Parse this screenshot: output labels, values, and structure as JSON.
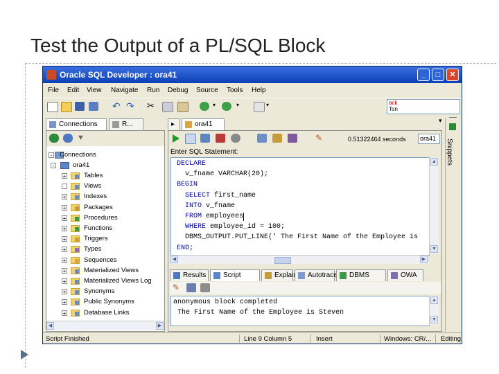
{
  "slide": {
    "title": "Test the Output of a PL/SQL Block"
  },
  "window": {
    "title": "Oracle SQL Developer : ora41",
    "controls": {
      "minimize": "_",
      "maximize": "□",
      "close": "✕"
    }
  },
  "menu": [
    "File",
    "Edit",
    "View",
    "Navigate",
    "Run",
    "Debug",
    "Source",
    "Tools",
    "Help"
  ],
  "search": {
    "line1": "ack",
    "line2": "Ton"
  },
  "left_panel": {
    "tabs": [
      "Connections",
      "R..."
    ],
    "root_label": "Connections",
    "connection_label": "ora41",
    "tree_items": [
      "Tables",
      "Views",
      "Indexes",
      "Packages",
      "Procedures",
      "Functions",
      "Triggers",
      "Types",
      "Sequences",
      "Materialized Views",
      "Materialized Views Log",
      "Synonyms",
      "Public Synonyms",
      "Database Links"
    ]
  },
  "editor": {
    "tab": "ora41",
    "timing": "0.51322464 seconds",
    "connection_select": "ora41",
    "prompt": "Enter SQL Statement:",
    "code_lines": [
      {
        "kw": "DECLARE",
        "rest": ""
      },
      {
        "kw": "",
        "rest": "  v_fname VARCHAR(20);"
      },
      {
        "kw": "BEGIN",
        "rest": ""
      },
      {
        "kw": "  SELECT",
        "rest": " first_name"
      },
      {
        "kw": "  INTO",
        "rest": " v_fname"
      },
      {
        "kw": "  FROM",
        "rest": " employees"
      },
      {
        "kw": "  WHERE",
        "rest": " employee_id = 100;"
      },
      {
        "kw": "",
        "rest": "  DBMS_OUTPUT.PUT_LINE(' The First Name of the Employee is"
      },
      {
        "kw": "END;",
        "rest": ""
      }
    ]
  },
  "snippets_label": "Snippets",
  "results": {
    "tabs": [
      "Results",
      "Script Output",
      "Explain",
      "Autotrace",
      "DBMS Output",
      "OWA C..."
    ],
    "output_lines": [
      "anonymous block completed",
      " The First Name of the Employee is Steven"
    ]
  },
  "status": {
    "left": "Script Finished",
    "position": "Line 9 Column 5",
    "mode": "Insert",
    "platform": "Windows: CR/...",
    "state": "Editing"
  }
}
